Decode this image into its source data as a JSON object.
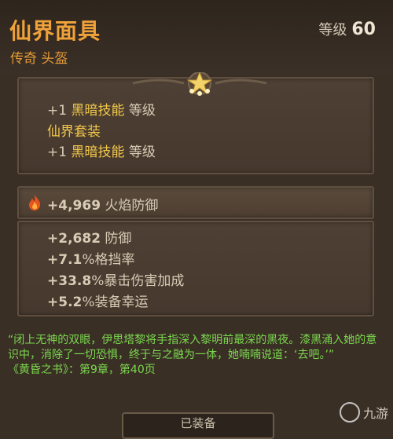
{
  "item": {
    "name": "仙界面具",
    "rarity_slot": "传奇 头盔",
    "level_label": "等级",
    "level_value": "60"
  },
  "affixes": {
    "line1_prefix": "+1 ",
    "line1_skill": "黑暗技能",
    "line1_suffix": " 等级",
    "set_name": "仙界套装",
    "line2_prefix": "+1 ",
    "line2_skill": "黑暗技能",
    "line2_suffix": " 等级"
  },
  "primary_stat": {
    "icon": "fire-icon",
    "value": "+4,969",
    "label": "火焰防御"
  },
  "stats": [
    {
      "value": "+2,682",
      "label": " 防御"
    },
    {
      "value": "+7.1",
      "label": "%格挡率"
    },
    {
      "value": "+33.8",
      "label": "%暴击伤害加成"
    },
    {
      "value": "+5.2",
      "label": "%装备幸运"
    }
  ],
  "lore": {
    "text": "“闭上无神的双眼，伊思塔黎将手指深入黎明前最深的黑夜。漆黑涌入她的意识中，消除了一切恐惧，终于与之融为一体，她喃喃说道：‘去吧。’”",
    "source": "《黄昏之书》：第9章，第40页"
  },
  "bottom_button": "已装备",
  "watermark": "九游"
}
